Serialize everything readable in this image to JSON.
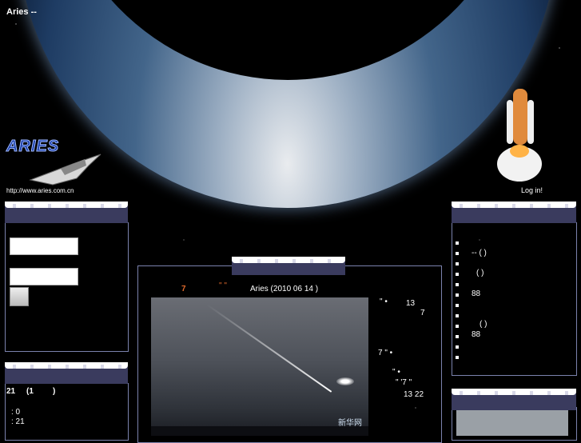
{
  "header": {
    "site_title": "Aries --",
    "logo_text": "ARIES",
    "site_url": "http://www.aries.com.cn",
    "login_link": "Log in!"
  },
  "left_panel_1": {
    "username_value": "",
    "password_value": ""
  },
  "left_panel_2": {
    "line1_a": "21",
    "line1_b": "(1",
    "line1_c": ")",
    "line2": ": 0",
    "line3": ": 21"
  },
  "center": {
    "headline_num": "7",
    "headline_quote": "\"  \"",
    "headline_byline": "Aries (2010 06 14 )",
    "side_texts": [
      "\" •",
      "13",
      "7",
      "7 \"  •",
      "\" •",
      "\" '7  \"",
      "13 22"
    ],
    "watermark": "新华网"
  },
  "right_panel": {
    "items": [
      "",
      "-- ( )",
      "( )",
      "",
      "88",
      "",
      "( )",
      "88",
      "",
      ""
    ]
  },
  "colors": {
    "panel_border": "#7b82ad",
    "panel_header": "#3a3b5e",
    "headline_num": "#e06a2c"
  }
}
